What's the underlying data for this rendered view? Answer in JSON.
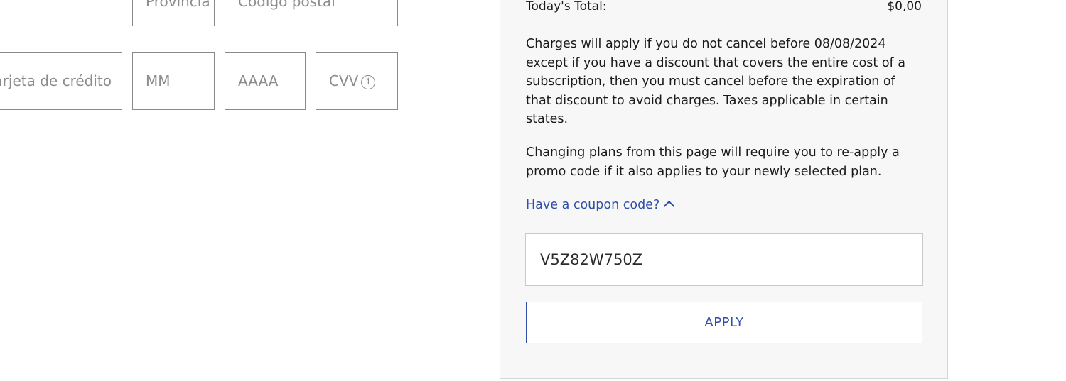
{
  "billing": {
    "province_placeholder": "Provincia",
    "postal_placeholder": "Código postal",
    "card_number_placeholder": "Número de tarjeta de crédito",
    "month_placeholder": "MM",
    "year_placeholder": "AAAA",
    "cvv_placeholder": "CVV"
  },
  "summary": {
    "total_label": "Today's Total:",
    "total_value": "$0,00",
    "charges_notice": "Charges will apply if you do not cancel before 08/08/2024 except if you have a discount that covers the entire cost of a subscription, then you must cancel before the expiration of that discount to avoid charges. Taxes applicable in certain states.",
    "plans_notice": "Changing plans from this page will require you to re-apply a promo code if it also applies to your newly selected plan.",
    "coupon_toggle_label": "Have a coupon code?",
    "coupon_value": "V5Z82W750Z",
    "apply_label": "APPLY"
  },
  "colors": {
    "link": "#2e4fa8",
    "panel_bg": "#f7f7f7",
    "field_border": "#8a8a8a"
  }
}
